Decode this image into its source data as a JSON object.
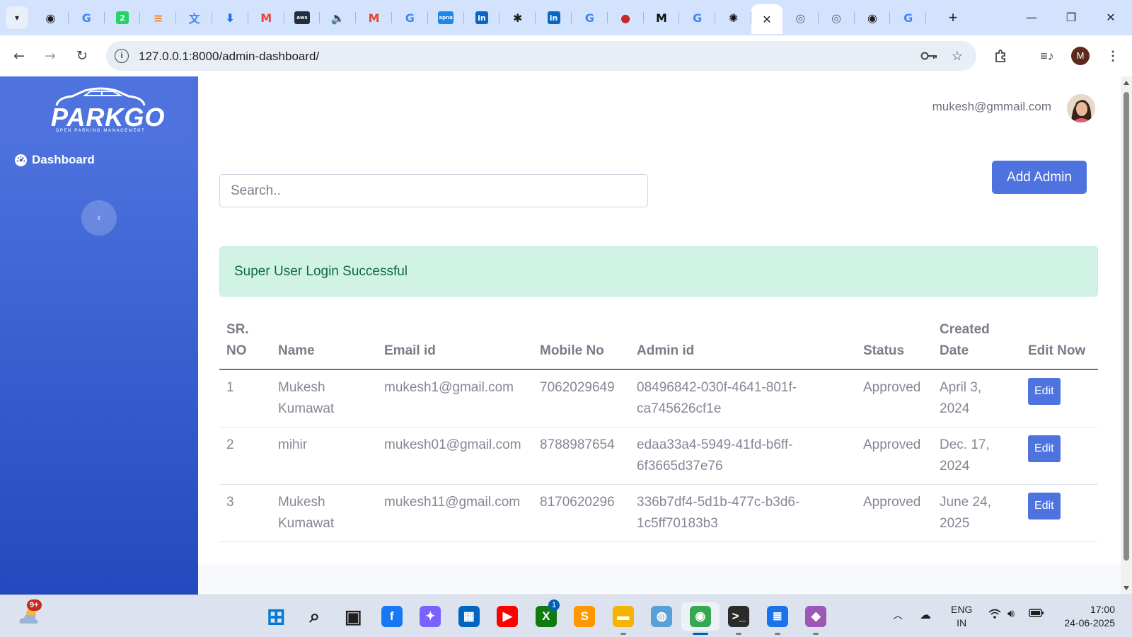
{
  "browser": {
    "tabs": [
      {
        "icon": "github-icon",
        "glyph": "◉",
        "color": "#1f1f1f"
      },
      {
        "icon": "google-icon",
        "glyph": "G",
        "color": "#4285f4"
      },
      {
        "icon": "whatsapp-icon",
        "glyph": "2",
        "color": "#25d366"
      },
      {
        "icon": "stackoverflow-icon",
        "glyph": "≡",
        "color": "#f48024"
      },
      {
        "icon": "google-translate-icon",
        "glyph": "文",
        "color": "#4285f4"
      },
      {
        "icon": "download-icon",
        "glyph": "⬇",
        "color": "#1a73e8"
      },
      {
        "icon": "gmail-icon",
        "glyph": "M",
        "color": "#ea4335"
      },
      {
        "icon": "aws-icon",
        "glyph": "aws",
        "color": "#232f3e"
      },
      {
        "icon": "audio-icon",
        "glyph": "🔈",
        "color": "#5f6368"
      },
      {
        "icon": "gmail-icon",
        "glyph": "M",
        "color": "#ea4335"
      },
      {
        "icon": "google-icon",
        "glyph": "G",
        "color": "#4285f4"
      },
      {
        "icon": "apna-icon",
        "glyph": "apna",
        "color": "#1e88e5"
      },
      {
        "icon": "linkedin-icon",
        "glyph": "in",
        "color": "#0a66c2"
      },
      {
        "icon": "asterisk-icon",
        "glyph": "✱",
        "color": "#1f1f1f"
      },
      {
        "icon": "linkedin-icon",
        "glyph": "in",
        "color": "#0a66c2"
      },
      {
        "icon": "google-icon",
        "glyph": "G",
        "color": "#4285f4"
      },
      {
        "icon": "red-dot-icon",
        "glyph": "●",
        "color": "#c62828"
      },
      {
        "icon": "medium-icon",
        "glyph": "M",
        "color": "#111111"
      },
      {
        "icon": "google-icon",
        "glyph": "G",
        "color": "#4285f4"
      },
      {
        "icon": "openai-icon",
        "glyph": "✺",
        "color": "#111111"
      },
      {
        "icon": "close-icon",
        "glyph": "✕",
        "color": "#1f1f1f",
        "active": true
      },
      {
        "icon": "chrome-icon",
        "glyph": "◎",
        "color": "#5f6368"
      },
      {
        "icon": "chrome-icon",
        "glyph": "◎",
        "color": "#5f6368"
      },
      {
        "icon": "github-icon",
        "glyph": "◉",
        "color": "#1f1f1f"
      },
      {
        "icon": "google-icon",
        "glyph": "G",
        "color": "#4285f4"
      }
    ],
    "new_tab": "+",
    "url": "127.0.0.1:8000/admin-dashboard/",
    "profile_initial": "M"
  },
  "sidebar": {
    "brand_name": "PARKGO",
    "brand_tagline": "OPEN PARKING MANAGEMENT",
    "items": [
      {
        "label": "Dashboard",
        "icon": "gauge-icon"
      }
    ],
    "toggle_glyph": "‹"
  },
  "topbar": {
    "user_email": "mukesh@gmmail.com"
  },
  "main": {
    "search_placeholder": "Search..",
    "add_button": "Add Admin",
    "alert": "Super User Login Successful",
    "table": {
      "headers": [
        "SR. NO",
        "Name",
        "Email id",
        "Mobile No",
        "Admin id",
        "Status",
        "Created Date",
        "Edit Now"
      ],
      "rows": [
        {
          "sr": "1",
          "name": "Mukesh Kumawat",
          "email": "mukesh1@gmail.com",
          "mobile": "7062029649",
          "admin_id": "08496842-030f-4641-801f-ca745626cf1e",
          "status": "Approved",
          "created": "April 3, 2024",
          "action": "Edit"
        },
        {
          "sr": "2",
          "name": "mihir",
          "email": "mukesh01@gmail.com",
          "mobile": "8788987654",
          "admin_id": "edaa33a4-5949-41fd-b6ff-6f3665d37e76",
          "status": "Approved",
          "created": "Dec. 17, 2024",
          "action": "Edit"
        },
        {
          "sr": "3",
          "name": "Mukesh Kumawat",
          "email": "mukesh11@gmail.com",
          "mobile": "8170620296",
          "admin_id": "336b7df4-5d1b-477c-b3d6-1c5ff70183b3",
          "status": "Approved",
          "created": "June 24, 2025",
          "action": "Edit"
        }
      ]
    }
  },
  "taskbar": {
    "weather_badge": "9+",
    "apps": [
      {
        "icon": "windows-start-icon",
        "glyph": "⊞",
        "color": "#0078d4"
      },
      {
        "icon": "search-icon",
        "glyph": "⌕",
        "color": "#1f1f1f"
      },
      {
        "icon": "task-view-icon",
        "glyph": "▣",
        "color": "#1f1f1f"
      },
      {
        "icon": "facebook-icon",
        "glyph": "f",
        "color": "#1877f2"
      },
      {
        "icon": "copilot-icon",
        "glyph": "✦",
        "color": "#7b61ff"
      },
      {
        "icon": "microsoft-store-icon",
        "glyph": "▦",
        "color": "#0067c0"
      },
      {
        "icon": "youtube-icon",
        "glyph": "▶",
        "color": "#ff0000"
      },
      {
        "icon": "xbox-icon",
        "glyph": "X",
        "color": "#107c10",
        "badge": "1"
      },
      {
        "icon": "sublime-text-icon",
        "glyph": "S",
        "color": "#ff9800"
      },
      {
        "icon": "file-explorer-icon",
        "glyph": "▬",
        "color": "#f4b400",
        "running": true
      },
      {
        "icon": "camera-app-icon",
        "glyph": "◍",
        "color": "#5aa0d8"
      },
      {
        "icon": "chrome-icon",
        "glyph": "◉",
        "color": "#34a853",
        "active": true
      },
      {
        "icon": "terminal-icon",
        "glyph": ">_",
        "color": "#2b2b2b",
        "running": true
      },
      {
        "icon": "notepad-icon",
        "glyph": "≣",
        "color": "#1a73e8",
        "running": true
      },
      {
        "icon": "vs-icon",
        "glyph": "◆",
        "color": "#9b59b6",
        "running": true
      }
    ],
    "lang_top": "ENG",
    "lang_bottom": "IN",
    "time": "17:00",
    "date": "24-06-2025"
  }
}
